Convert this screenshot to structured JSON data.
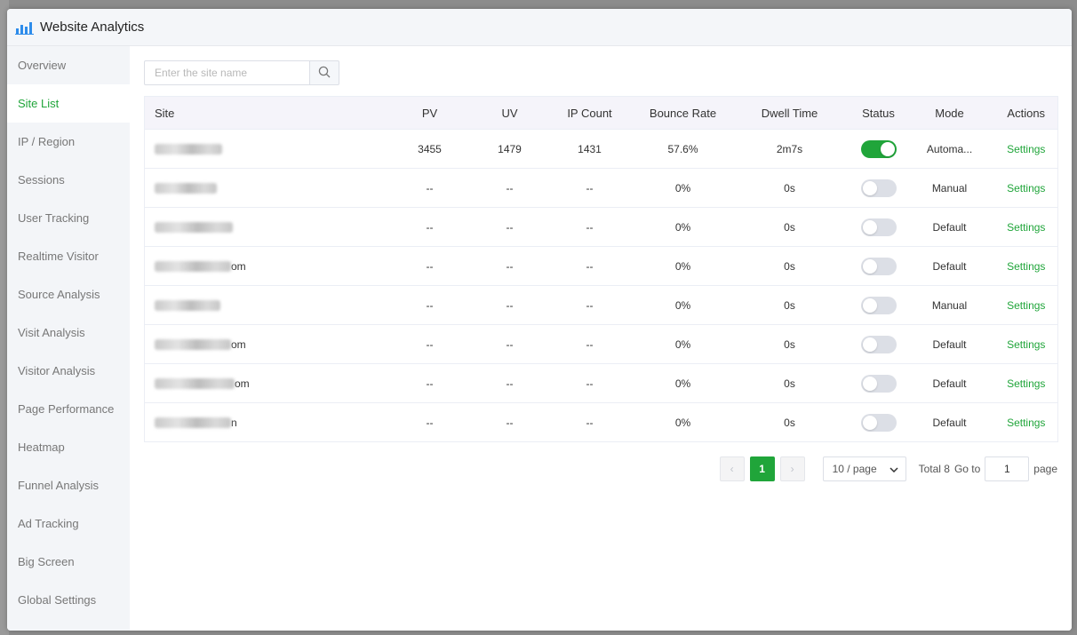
{
  "window": {
    "title": "Website Analytics"
  },
  "sidebar": {
    "items": [
      {
        "label": "Overview",
        "active": false
      },
      {
        "label": "Site List",
        "active": true
      },
      {
        "label": "IP / Region",
        "active": false
      },
      {
        "label": "Sessions",
        "active": false
      },
      {
        "label": "User Tracking",
        "active": false
      },
      {
        "label": "Realtime Visitor",
        "active": false
      },
      {
        "label": "Source Analysis",
        "active": false
      },
      {
        "label": "Visit Analysis",
        "active": false
      },
      {
        "label": "Visitor Analysis",
        "active": false
      },
      {
        "label": "Page Performance",
        "active": false
      },
      {
        "label": "Heatmap",
        "active": false
      },
      {
        "label": "Funnel Analysis",
        "active": false
      },
      {
        "label": "Ad Tracking",
        "active": false
      },
      {
        "label": "Big Screen",
        "active": false
      },
      {
        "label": "Global Settings",
        "active": false
      }
    ]
  },
  "search": {
    "placeholder": "Enter the site name",
    "value": "",
    "icon": "search-icon"
  },
  "table": {
    "columns": [
      "Site",
      "PV",
      "UV",
      "IP Count",
      "Bounce Rate",
      "Dwell Time",
      "Status",
      "Mode",
      "Actions"
    ],
    "rows": [
      {
        "site_suffix": "",
        "pv": "3455",
        "uv": "1479",
        "ip": "1431",
        "bounce": "57.6%",
        "dwell": "2m7s",
        "status_on": true,
        "mode": "Automa...",
        "action": "Settings"
      },
      {
        "site_suffix": "",
        "pv": "--",
        "uv": "--",
        "ip": "--",
        "bounce": "0%",
        "dwell": "0s",
        "status_on": false,
        "mode": "Manual",
        "action": "Settings"
      },
      {
        "site_suffix": "",
        "pv": "--",
        "uv": "--",
        "ip": "--",
        "bounce": "0%",
        "dwell": "0s",
        "status_on": false,
        "mode": "Default",
        "action": "Settings"
      },
      {
        "site_suffix": "om",
        "pv": "--",
        "uv": "--",
        "ip": "--",
        "bounce": "0%",
        "dwell": "0s",
        "status_on": false,
        "mode": "Default",
        "action": "Settings"
      },
      {
        "site_suffix": "",
        "pv": "--",
        "uv": "--",
        "ip": "--",
        "bounce": "0%",
        "dwell": "0s",
        "status_on": false,
        "mode": "Manual",
        "action": "Settings"
      },
      {
        "site_suffix": "om",
        "pv": "--",
        "uv": "--",
        "ip": "--",
        "bounce": "0%",
        "dwell": "0s",
        "status_on": false,
        "mode": "Default",
        "action": "Settings"
      },
      {
        "site_suffix": "om",
        "pv": "--",
        "uv": "--",
        "ip": "--",
        "bounce": "0%",
        "dwell": "0s",
        "status_on": false,
        "mode": "Default",
        "action": "Settings"
      },
      {
        "site_suffix": "n",
        "pv": "--",
        "uv": "--",
        "ip": "--",
        "bounce": "0%",
        "dwell": "0s",
        "status_on": false,
        "mode": "Default",
        "action": "Settings"
      }
    ]
  },
  "pagination": {
    "current_page": "1",
    "page_size": "10 / page",
    "total": "Total 8",
    "goto_label": "Go to",
    "goto_value": "1",
    "page_label": "page"
  },
  "colors": {
    "accent": "#20a53a",
    "sidebar_bg": "#f3f5f8",
    "header_bg": "#f5f4fa"
  }
}
